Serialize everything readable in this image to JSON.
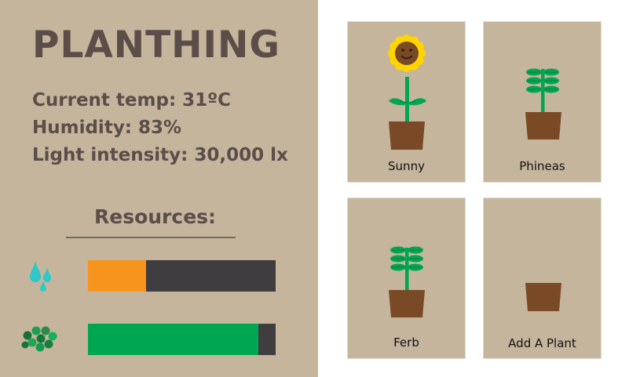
{
  "app": {
    "title": "PLANTHING"
  },
  "stats": {
    "temp": "Current temp: 31ºC",
    "humidity": "Humidity: 83%",
    "light": "Light intensity: 30,000 lx"
  },
  "resources": {
    "title": "Resources:",
    "water": {
      "icon": "water-drops-icon",
      "level": 0.31,
      "color": "#f7941d"
    },
    "nutrients": {
      "icon": "nutrient-pellets-icon",
      "level": 0.91,
      "color": "#00a651"
    }
  },
  "plants": [
    {
      "name": "Sunny",
      "type": "sunflower"
    },
    {
      "name": "Phineas",
      "type": "leafy-plant"
    },
    {
      "name": "Ferb",
      "type": "leafy-plant"
    },
    {
      "name": "Add A Plant",
      "type": "empty-pot"
    }
  ],
  "colors": {
    "panel": "#c4b59c",
    "text": "#5b4d48",
    "pot": "#7a4a27",
    "leaf": "#00a651",
    "petal": "#ffd400"
  }
}
